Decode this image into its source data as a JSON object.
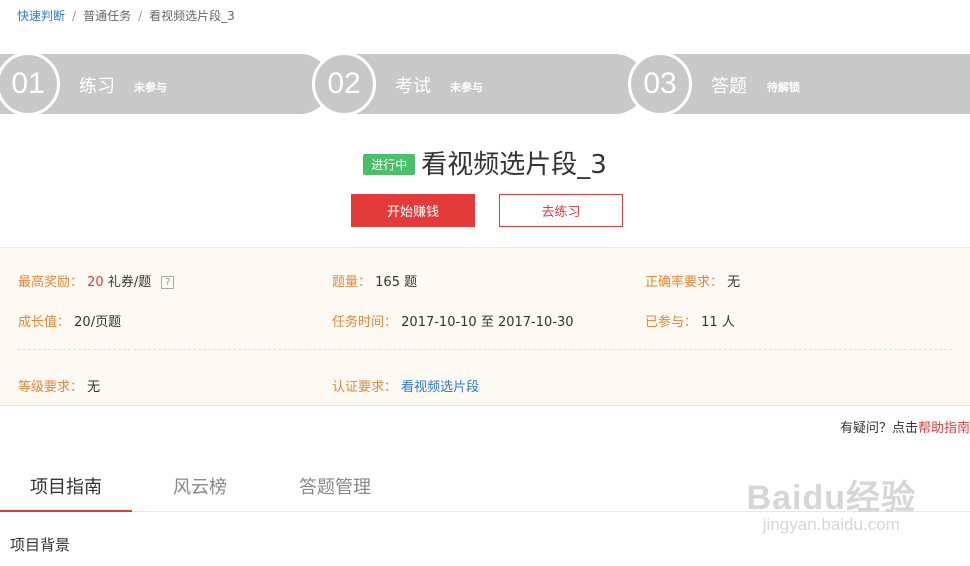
{
  "breadcrumb": {
    "items": [
      "快速判断",
      "普通任务",
      "看视频选片段_3"
    ],
    "separator": "/"
  },
  "steps": [
    {
      "number": "01",
      "name": "练习",
      "status": "未参与"
    },
    {
      "number": "02",
      "name": "考试",
      "status": "未参与"
    },
    {
      "number": "03",
      "name": "答题",
      "status": "待解锁"
    }
  ],
  "task": {
    "badge": "进行中",
    "title": "看视频选片段_3",
    "primary_button": "开始赚钱",
    "secondary_button": "去练习"
  },
  "info": {
    "max_reward_label": "最高奖励：",
    "max_reward_value": "20",
    "max_reward_unit": "礼券/题",
    "help_mark": "?",
    "question_count_label": "题量：",
    "question_count_value": "165 题",
    "accuracy_label": "正确率要求：",
    "accuracy_value": "无",
    "growth_label": "成长值：",
    "growth_value": "20/页题",
    "time_label": "任务时间：",
    "time_value": "2017-10-10 至 2017-10-30",
    "joined_label": "已参与：",
    "joined_value": "11 人",
    "level_label": "等级要求：",
    "level_value": "无",
    "cert_label": "认证要求：",
    "cert_value": "看视频选片段"
  },
  "help": {
    "text": "有疑问？点击",
    "link": "帮助指南"
  },
  "tabs": [
    "项目指南",
    "风云榜",
    "答题管理"
  ],
  "section_title": "项目背景",
  "watermark": {
    "main": "Baidu经验",
    "sub": "jingyan.baidu.com"
  },
  "colors": {
    "accent_red": "#e33a3a",
    "badge_green": "#4cbf6b",
    "label_orange": "#e3883c",
    "link_blue": "#2d7bd2",
    "step_gray": "#c8c8c8"
  }
}
